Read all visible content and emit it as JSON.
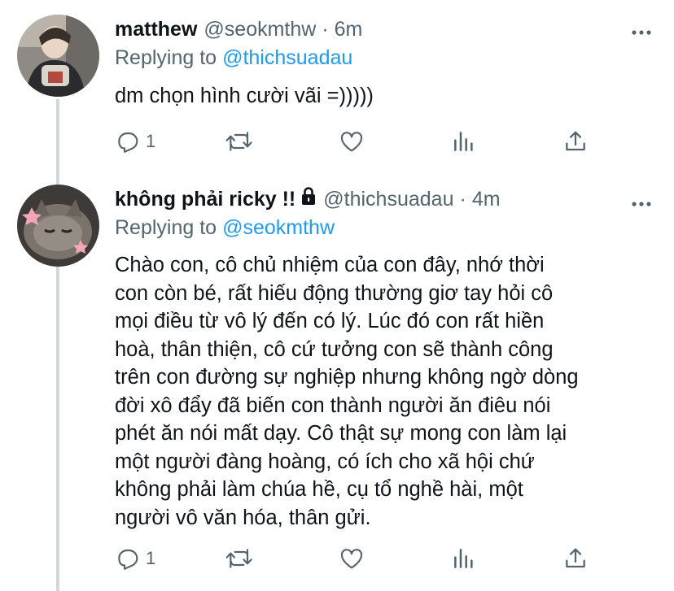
{
  "tweets": [
    {
      "display_name": "matthew",
      "handle": "@seokmthw",
      "separator": "·",
      "time": "6m",
      "replying_to_label": "Replying to",
      "replying_to_handle": "@thichsuadau",
      "text": "dm chọn hình cười vãi =)))))",
      "reply_count": "1",
      "protected": false
    },
    {
      "display_name": "không phải ricky !!",
      "handle": "@thichsuadau",
      "separator": "·",
      "time": "4m",
      "replying_to_label": "Replying to",
      "replying_to_handle": "@seokmthw",
      "text_lines": [
        "Chào con, cô chủ nhiệm của con đây, nhớ thời",
        "con còn bé, rất hiếu động thường giơ tay hỏi cô",
        "mọi điều từ vô lý đến có lý. Lúc đó con rất hiền",
        "hoà, thân thiện, cô cứ tưởng con sẽ thành công",
        "trên con đường sự nghiệp nhưng không ngờ dòng",
        "đời xô đẩy đã biến con thành người ăn điêu nói",
        "phét ăn nói mất dạy. Cô thật sự mong con làm lại",
        "một người đàng hoàng, có ích cho xã hội chứ",
        "không phải làm chúa hề, cụ tổ nghề hài, một",
        "người vô văn hóa, thân gửi."
      ],
      "reply_count": "1",
      "protected": true
    }
  ],
  "icons": {
    "reply": "reply-icon",
    "retweet": "retweet-icon",
    "like": "like-icon",
    "analytics": "analytics-icon",
    "share": "share-icon",
    "more": "more-icon",
    "lock": "lock-icon"
  },
  "colors": {
    "link": "#1d9bf0",
    "secondary_text": "#536471",
    "primary_text": "#0f1419",
    "thread_line": "#cfd9de"
  }
}
